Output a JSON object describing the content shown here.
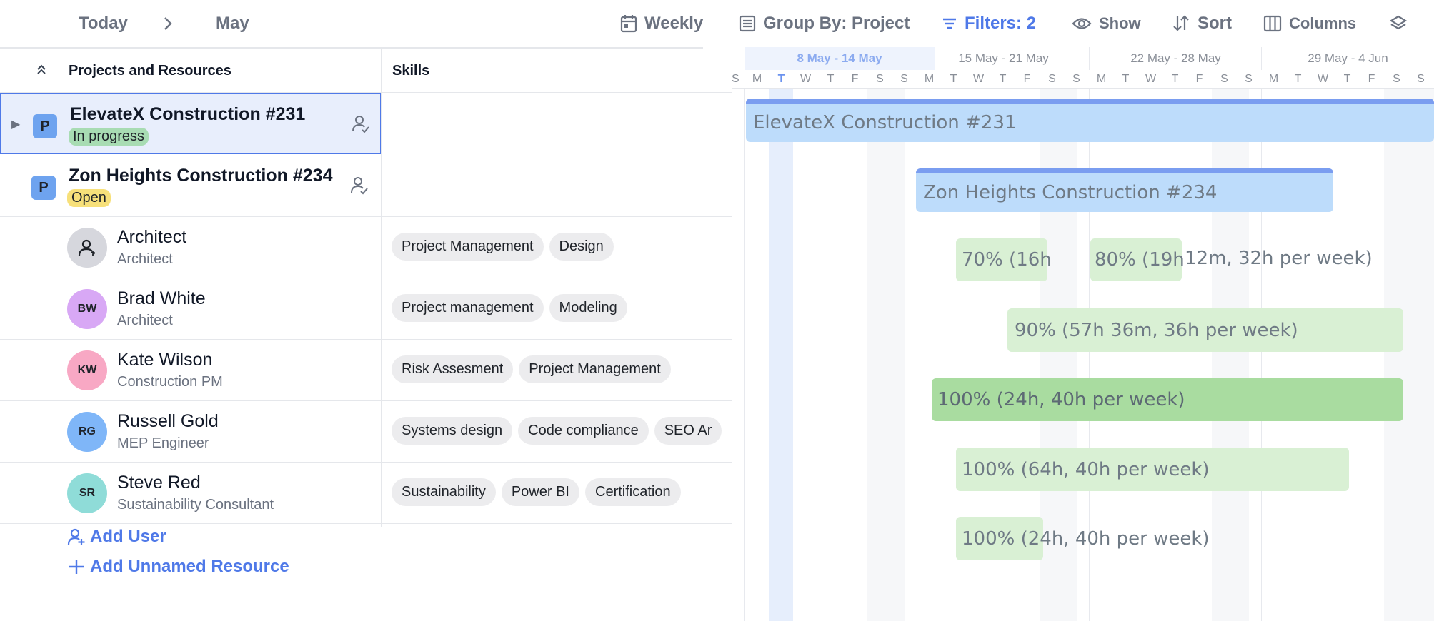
{
  "toolbar": {
    "today": "Today",
    "month": "May",
    "weekly": "Weekly",
    "group_by": "Group By: Project",
    "filters": "Filters: 2",
    "show": "Show",
    "sort": "Sort",
    "columns": "Columns"
  },
  "grid_header": {
    "projects": "Projects and Resources",
    "skills": "Skills"
  },
  "projects": [
    {
      "badge": "P",
      "name": "ElevateX Construction #231",
      "status": "In progress"
    },
    {
      "badge": "P",
      "name": "Zon Heights Construction #234",
      "status": "Open"
    }
  ],
  "resources": [
    {
      "initials": "",
      "name": "Architect",
      "role": "Architect",
      "avatar_color": "#d6d7dd",
      "skills": [
        "Project Management",
        "Design"
      ]
    },
    {
      "initials": "BW",
      "name": "Brad White",
      "role": "Architect",
      "avatar_color": "#d8a8f5",
      "skills": [
        "Project management",
        "Modeling"
      ]
    },
    {
      "initials": "KW",
      "name": "Kate Wilson",
      "role": "Construction PM",
      "avatar_color": "#f8a8c4",
      "skills": [
        "Risk Assesment",
        "Project Management"
      ]
    },
    {
      "initials": "RG",
      "name": "Russell Gold",
      "role": "MEP Engineer",
      "avatar_color": "#7fb6f8",
      "skills": [
        "Systems design",
        "Code compliance",
        "SEO Ar"
      ]
    },
    {
      "initials": "SR",
      "name": "Steve Red",
      "role": "Sustainability Consultant",
      "avatar_color": "#8fdcd8",
      "skills": [
        "Sustainability",
        "Power BI",
        "Certification"
      ]
    }
  ],
  "add_actions": {
    "add_user": "Add User",
    "add_unnamed": "Add Unnamed Resource"
  },
  "gantt": {
    "weeks": [
      "8 May - 14 May",
      "15 May - 21 May",
      "22 May - 28 May",
      "29 May - 4 Jun"
    ],
    "lead_day": "S",
    "days": [
      "M",
      "T",
      "W",
      "T",
      "F",
      "S",
      "S"
    ],
    "today_label": "T",
    "bars": {
      "project_1": "ElevateX Construction #231",
      "project_2": "Zon Heights Construction #234",
      "architect_a": "70% (16h",
      "architect_b": "80% (19h",
      "architect_tail": "12m, 32h per week)",
      "brad": "90% (57h 36m, 36h per week)",
      "kate": "100% (24h, 40h per week)",
      "russell": "100% (64h, 40h per week)",
      "steve": "100% (24h, 40h per week)"
    }
  }
}
